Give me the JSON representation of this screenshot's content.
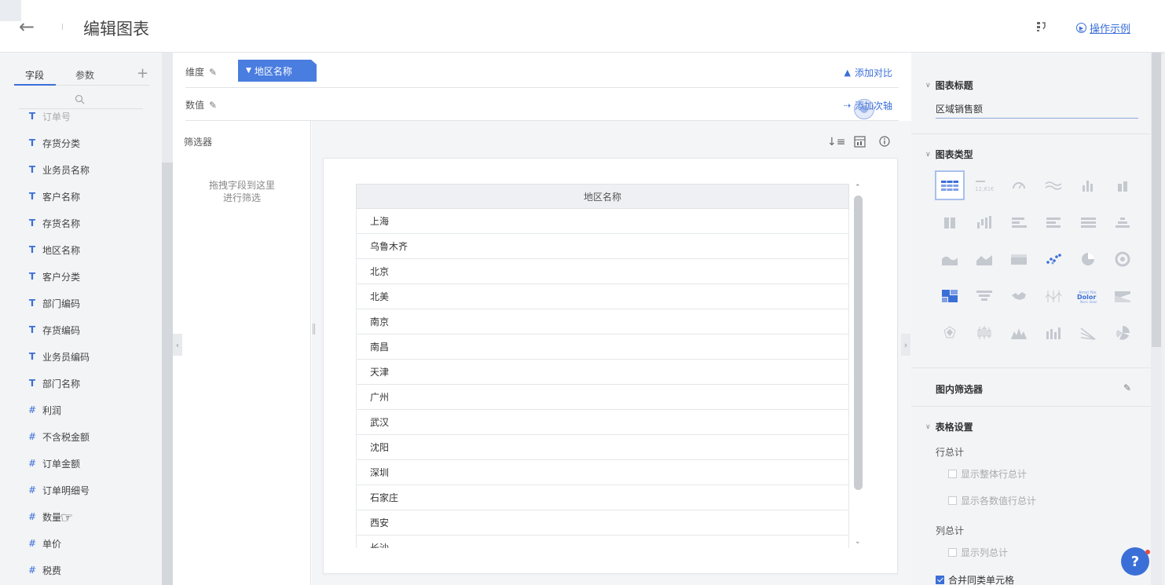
{
  "header": {
    "title": "编辑图表",
    "back_icon": "arrow-left-icon",
    "example_label": "操作示例"
  },
  "left_panel": {
    "tabs": [
      {
        "label": "字段",
        "active": true
      },
      {
        "label": "参数",
        "active": false
      }
    ],
    "fields": [
      {
        "type": "T",
        "label": "订单号"
      },
      {
        "type": "T",
        "label": "存货分类"
      },
      {
        "type": "T",
        "label": "业务员名称"
      },
      {
        "type": "T",
        "label": "客户名称"
      },
      {
        "type": "T",
        "label": "存货名称"
      },
      {
        "type": "T",
        "label": "地区名称"
      },
      {
        "type": "T",
        "label": "客户分类"
      },
      {
        "type": "T",
        "label": "部门编码"
      },
      {
        "type": "T",
        "label": "存货编码"
      },
      {
        "type": "T",
        "label": "业务员编码"
      },
      {
        "type": "T",
        "label": "部门名称"
      },
      {
        "type": "#",
        "label": "利润"
      },
      {
        "type": "#",
        "label": "不含税金额"
      },
      {
        "type": "#",
        "label": "订单金额"
      },
      {
        "type": "#",
        "label": "订单明细号"
      },
      {
        "type": "#",
        "label": "数量"
      },
      {
        "type": "#",
        "label": "单价"
      },
      {
        "type": "#",
        "label": "税费"
      }
    ]
  },
  "editor": {
    "dimension_label": "维度",
    "dimension_chip": "地区名称",
    "add_compare": "添加对比",
    "value_label": "数值",
    "add_secondary_axis": "添加次轴",
    "filter_title": "筛选器",
    "filter_hint_1": "拖拽字段到这里",
    "filter_hint_2": "进行筛选"
  },
  "table": {
    "header": "地区名称",
    "rows": [
      "上海",
      "乌鲁木齐",
      "北京",
      "北美",
      "南京",
      "南昌",
      "天津",
      "广州",
      "武汉",
      "沈阳",
      "深圳",
      "石家庄",
      "西安",
      "长沙"
    ]
  },
  "right_panel": {
    "chart_title_section": "图表标题",
    "chart_title_value": "区域销售额",
    "chart_type_section": "图表类型",
    "inner_filter": "图内筛选器",
    "table_settings": "表格设置",
    "row_total_label": "行总计",
    "row_total_opt1": "显示整体行总计",
    "row_total_opt2": "显示各数值行总计",
    "col_total_label": "列总计",
    "col_total_opt1": "显示列总计",
    "merge_cells": "合并同类单元格",
    "merge_cells_checked": true
  },
  "colors": {
    "accent": "#3b6fd8",
    "chip": "#4a7de0"
  }
}
